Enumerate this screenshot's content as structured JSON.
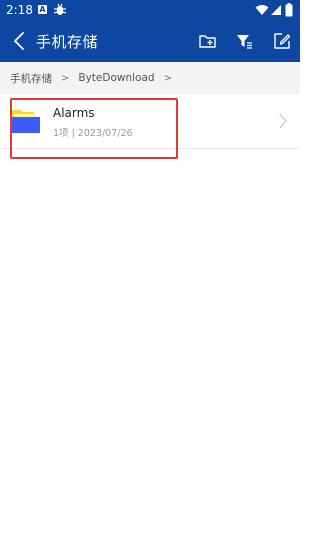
{
  "status_bar": {
    "time": "2:18",
    "badge_letter": "A",
    "icons": [
      "notification-a-icon",
      "debug-bug-icon",
      "wifi-icon",
      "signal-icon",
      "battery-icon"
    ]
  },
  "app_bar": {
    "title": "手机存储",
    "icons": [
      "back-arrow-icon",
      "new-folder-icon",
      "filter-icon",
      "edit-icon"
    ]
  },
  "breadcrumb": {
    "items": [
      "手机存储",
      "ByteDownload"
    ],
    "separator": ">"
  },
  "files": [
    {
      "name": "Alarms",
      "meta": "1项 | 2023/07/26",
      "icon": "folder-icon"
    }
  ],
  "colors": {
    "accent": "#0d47a1",
    "folder_yellow": "#fdd835",
    "folder_blue": "#3d5afe",
    "highlight": "#e53935"
  }
}
